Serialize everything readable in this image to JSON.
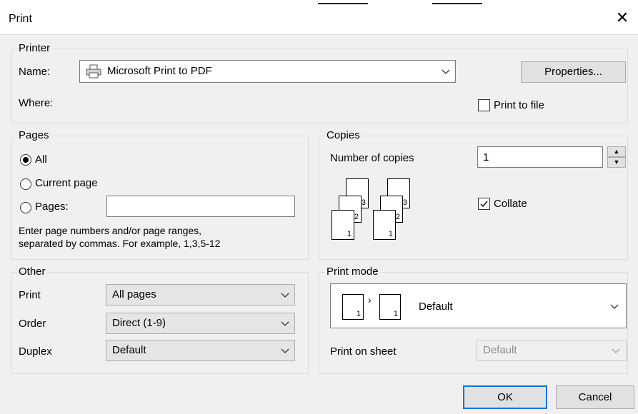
{
  "window": {
    "title": "Print"
  },
  "printer": {
    "legend": "Printer",
    "name_label": "Name:",
    "name_value": "Microsoft Print to PDF",
    "where_label": "Where:",
    "properties_button": "Properties...",
    "print_to_file_label": "Print to file",
    "print_to_file_checked": false
  },
  "pages": {
    "legend": "Pages",
    "all_label": "All",
    "current_label": "Current page",
    "pages_label": "Pages:",
    "pages_value": "",
    "selected": "All",
    "hint_line1": "Enter page numbers and/or page ranges,",
    "hint_line2": "separated by commas. For example, 1,3,5-12"
  },
  "copies": {
    "legend": "Copies",
    "number_label": "Number of copies",
    "number_value": "1",
    "collate_label": "Collate",
    "collate_checked": true
  },
  "other": {
    "legend": "Other",
    "print_label": "Print",
    "print_value": "All pages",
    "order_label": "Order",
    "order_value": "Direct (1-9)",
    "duplex_label": "Duplex",
    "duplex_value": "Default"
  },
  "print_mode": {
    "legend": "Print mode",
    "mode_value": "Default",
    "sheet_label": "Print on sheet",
    "sheet_value": "Default"
  },
  "buttons": {
    "ok": "OK",
    "cancel": "Cancel"
  },
  "colors": {
    "accent": "#0078d7",
    "background": "#f0f0f0"
  }
}
